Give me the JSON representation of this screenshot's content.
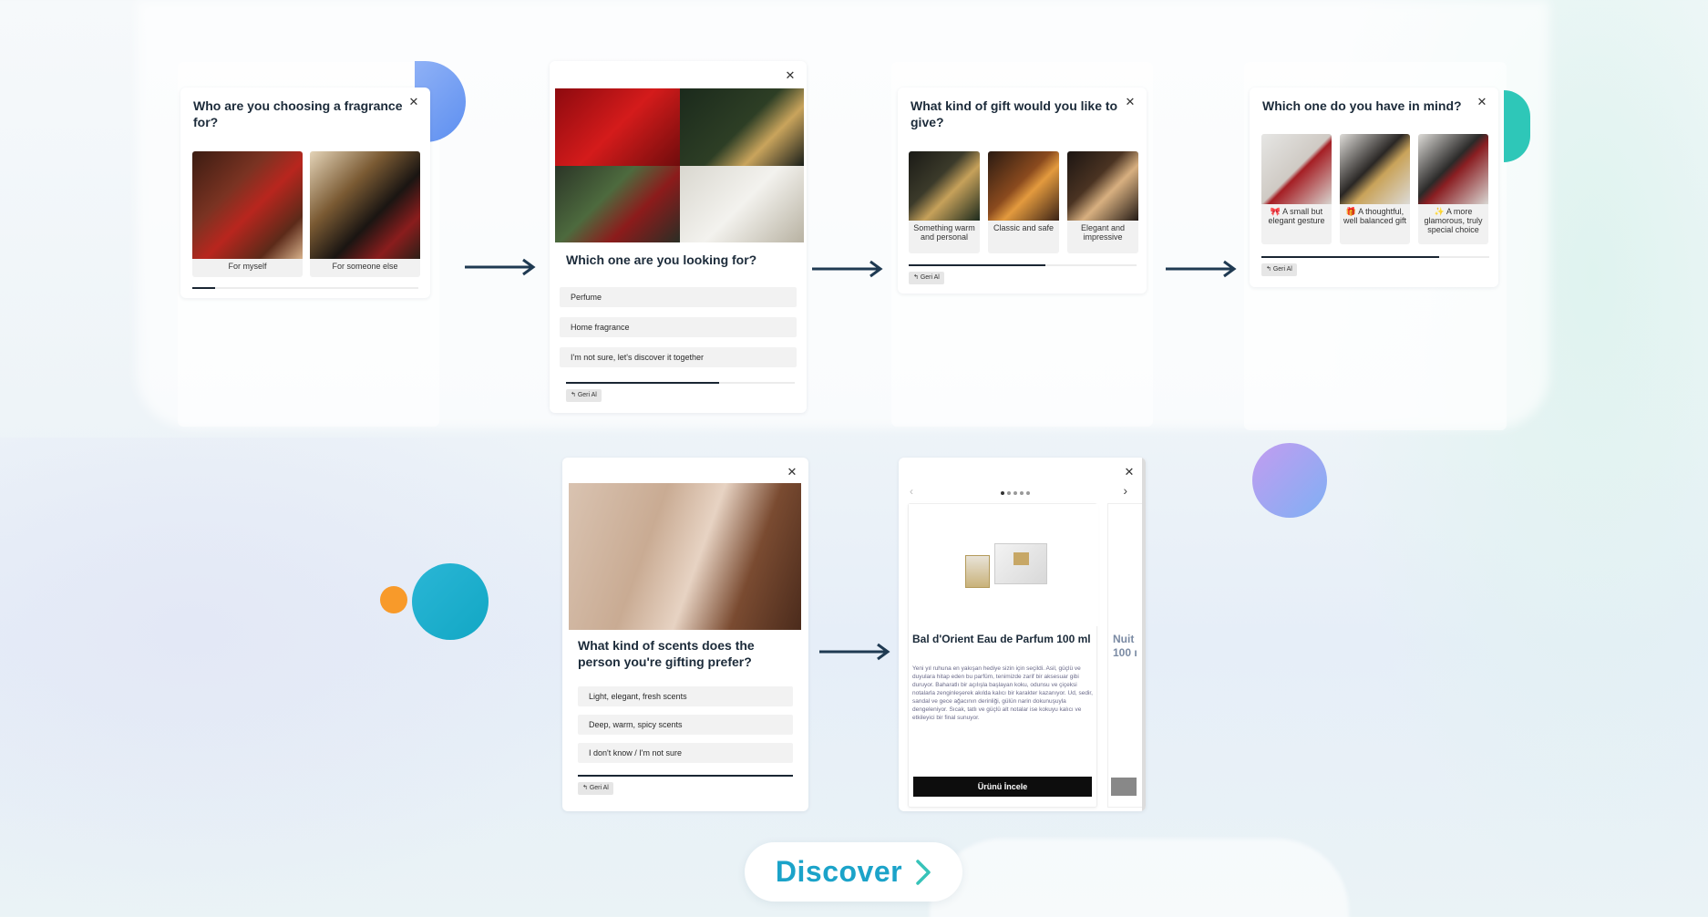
{
  "cards": {
    "c1": {
      "title": "Who are you choosing a fragrance for?",
      "options": [
        "For myself",
        "For someone else"
      ],
      "progress": 0.1
    },
    "c2": {
      "title": "Which one are you looking for?",
      "options": [
        "Perfume",
        "Home fragrance",
        "I'm not sure, let's discover it together"
      ],
      "progress": 0.67,
      "back": "Geri Al"
    },
    "c3": {
      "title": "What kind of gift would you like to give?",
      "options": [
        "Something warm and personal",
        "Classic and safe",
        "Elegant and impressive"
      ],
      "progress": 0.6,
      "back": "Geri Al"
    },
    "c4": {
      "title": "Which one do you have in mind?",
      "options": [
        "🎀 A small but elegant gesture",
        "🎁 A thoughtful, well balanced gift",
        "✨ A more glamorous, truly special choice"
      ],
      "progress": 0.78,
      "back": "Geri Al"
    },
    "c5": {
      "title": "What kind of scents does the person you're gifting prefer?",
      "options": [
        "Light, elegant, fresh scents",
        "Deep, warm, spicy scents",
        "I don't know / I'm not sure"
      ],
      "progress": 1.0,
      "back": "Geri Al"
    },
    "c6": {
      "product_title": "Bal d'Orient Eau de Parfum 100 ml",
      "product_desc": "Yeni yıl ruhuna en yakışan hediye sizin için seçildi. Asil, güçlü ve duyulara hitap eden bu parfüm, tenimizde zarif bir aksesuar gibi duruyor. Baharatlı bir açılışla başlayan koku, odunsu ve çiçeksi notalarla zenginleşerek akılda kalıcı bir karakter kazanıyor. Ud, sedir, sandal ve gece ağacının derinliği, gülün narin dokunuşuyla dengeleniyor. Sıcak, tatlı ve güçlü alt notalar ise kokuyu kalıcı ve etkileyici bir final sunuyor.",
      "cta": "Ürünü İncele",
      "peek_title": "Nuit 100 ı",
      "dots_count": 5,
      "active_dot": 0
    }
  },
  "cta": {
    "label": "Discover"
  },
  "colors": {
    "accent": "#1ba3c9",
    "dark": "#1c2b3a",
    "arrow": "#1f3a52"
  }
}
